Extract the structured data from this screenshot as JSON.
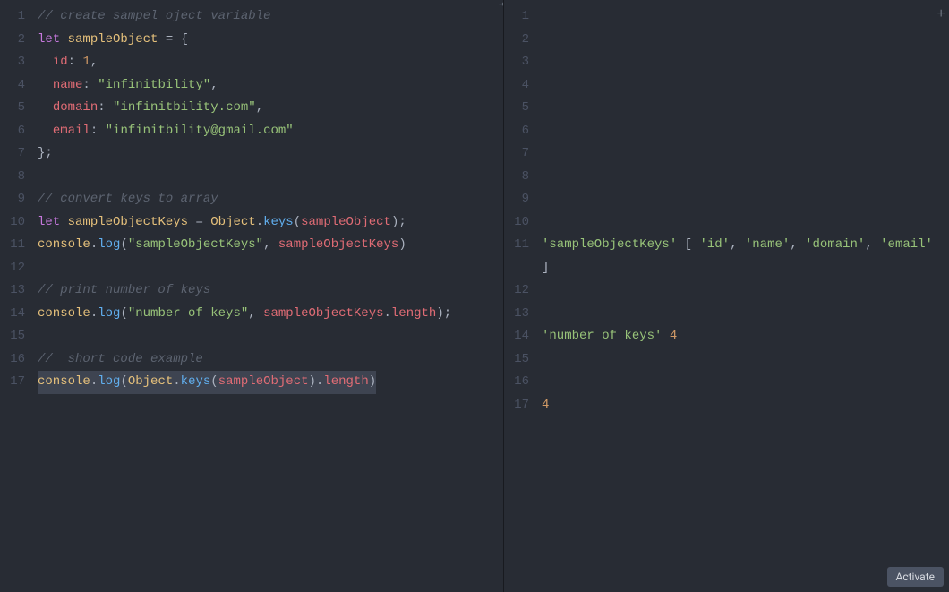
{
  "leftPane": {
    "lines": [
      {
        "n": 1,
        "tokens": [
          [
            "tk-comment",
            "// create sampel oject variable"
          ]
        ]
      },
      {
        "n": 2,
        "tokens": [
          [
            "tk-keyword",
            "let"
          ],
          [
            "tk-default",
            " "
          ],
          [
            "tk-var",
            "sampleObject"
          ],
          [
            "tk-default",
            " "
          ],
          [
            "tk-op",
            "="
          ],
          [
            "tk-default",
            " "
          ],
          [
            "tk-punc",
            "{"
          ]
        ]
      },
      {
        "n": 3,
        "tokens": [
          [
            "tk-default",
            "  "
          ],
          [
            "tk-prop",
            "id"
          ],
          [
            "tk-punc",
            ":"
          ],
          [
            "tk-default",
            " "
          ],
          [
            "tk-num",
            "1"
          ],
          [
            "tk-punc",
            ","
          ]
        ]
      },
      {
        "n": 4,
        "tokens": [
          [
            "tk-default",
            "  "
          ],
          [
            "tk-prop",
            "name"
          ],
          [
            "tk-punc",
            ":"
          ],
          [
            "tk-default",
            " "
          ],
          [
            "tk-str",
            "\"infinitbility\""
          ],
          [
            "tk-punc",
            ","
          ]
        ]
      },
      {
        "n": 5,
        "tokens": [
          [
            "tk-default",
            "  "
          ],
          [
            "tk-prop",
            "domain"
          ],
          [
            "tk-punc",
            ":"
          ],
          [
            "tk-default",
            " "
          ],
          [
            "tk-str",
            "\"infinitbility.com\""
          ],
          [
            "tk-punc",
            ","
          ]
        ]
      },
      {
        "n": 6,
        "tokens": [
          [
            "tk-default",
            "  "
          ],
          [
            "tk-prop",
            "email"
          ],
          [
            "tk-punc",
            ":"
          ],
          [
            "tk-default",
            " "
          ],
          [
            "tk-str",
            "\"infinitbility@gmail.com\""
          ]
        ]
      },
      {
        "n": 7,
        "tokens": [
          [
            "tk-punc",
            "};"
          ]
        ]
      },
      {
        "n": 8,
        "tokens": []
      },
      {
        "n": 9,
        "tokens": [
          [
            "tk-comment",
            "// convert keys to array"
          ]
        ]
      },
      {
        "n": 10,
        "tokens": [
          [
            "tk-keyword",
            "let"
          ],
          [
            "tk-default",
            " "
          ],
          [
            "tk-var",
            "sampleObjectKeys"
          ],
          [
            "tk-default",
            " "
          ],
          [
            "tk-op",
            "="
          ],
          [
            "tk-default",
            " "
          ],
          [
            "tk-class",
            "Object"
          ],
          [
            "tk-punc",
            "."
          ],
          [
            "tk-func",
            "keys"
          ],
          [
            "tk-punc",
            "("
          ],
          [
            "tk-ident",
            "sampleObject"
          ],
          [
            "tk-punc",
            ")"
          ],
          [
            "tk-punc",
            ";"
          ]
        ]
      },
      {
        "n": 11,
        "tokens": [
          [
            "tk-class",
            "console"
          ],
          [
            "tk-punc",
            "."
          ],
          [
            "tk-func",
            "log"
          ],
          [
            "tk-punc",
            "("
          ],
          [
            "tk-str",
            "\"sampleObjectKeys\""
          ],
          [
            "tk-punc",
            ","
          ],
          [
            "tk-default",
            " "
          ],
          [
            "tk-ident",
            "sampleObjectKeys"
          ],
          [
            "tk-punc",
            ")"
          ]
        ]
      },
      {
        "n": 12,
        "tokens": []
      },
      {
        "n": 13,
        "tokens": [
          [
            "tk-comment",
            "// print number of keys"
          ]
        ]
      },
      {
        "n": 14,
        "tokens": [
          [
            "tk-class",
            "console"
          ],
          [
            "tk-punc",
            "."
          ],
          [
            "tk-func",
            "log"
          ],
          [
            "tk-punc",
            "("
          ],
          [
            "tk-str",
            "\"number of keys\""
          ],
          [
            "tk-punc",
            ","
          ],
          [
            "tk-default",
            " "
          ],
          [
            "tk-ident",
            "sampleObjectKeys"
          ],
          [
            "tk-punc",
            "."
          ],
          [
            "tk-prop",
            "length"
          ],
          [
            "tk-punc",
            ")"
          ],
          [
            "tk-punc",
            ";"
          ]
        ]
      },
      {
        "n": 15,
        "tokens": []
      },
      {
        "n": 16,
        "tokens": [
          [
            "tk-comment",
            "//  short code example"
          ]
        ]
      },
      {
        "n": 17,
        "selected": true,
        "tokens": [
          [
            "tk-class",
            "console"
          ],
          [
            "tk-punc",
            "."
          ],
          [
            "tk-func",
            "log"
          ],
          [
            "tk-punc",
            "("
          ],
          [
            "tk-class",
            "Object"
          ],
          [
            "tk-punc",
            "."
          ],
          [
            "tk-func",
            "keys"
          ],
          [
            "tk-punc",
            "("
          ],
          [
            "tk-ident",
            "sampleObject"
          ],
          [
            "tk-punc",
            ")"
          ],
          [
            "tk-punc",
            "."
          ],
          [
            "tk-prop",
            "length"
          ],
          [
            "tk-punc",
            ")"
          ]
        ]
      }
    ]
  },
  "rightPane": {
    "lines": [
      {
        "n": 1,
        "tokens": []
      },
      {
        "n": 2,
        "tokens": []
      },
      {
        "n": 3,
        "tokens": []
      },
      {
        "n": 4,
        "tokens": []
      },
      {
        "n": 5,
        "tokens": []
      },
      {
        "n": 6,
        "tokens": []
      },
      {
        "n": 7,
        "tokens": []
      },
      {
        "n": 8,
        "tokens": []
      },
      {
        "n": 9,
        "tokens": []
      },
      {
        "n": 10,
        "tokens": []
      },
      {
        "n": 11,
        "wrap": true,
        "tokens": [
          [
            "out-str",
            "'sampleObjectKeys'"
          ],
          [
            "out-def",
            " "
          ],
          [
            "out-def",
            "["
          ],
          [
            "out-def",
            " "
          ],
          [
            "out-str",
            "'id'"
          ],
          [
            "out-def",
            ", "
          ],
          [
            "out-str",
            "'name'"
          ],
          [
            "out-def",
            ", "
          ],
          [
            "out-str",
            "'domain'"
          ],
          [
            "out-def",
            ", "
          ],
          [
            "out-str",
            "'email'"
          ],
          [
            "out-def",
            " "
          ],
          [
            "out-def",
            "]"
          ]
        ]
      },
      {
        "n": 12,
        "tokens": []
      },
      {
        "n": 13,
        "tokens": []
      },
      {
        "n": 14,
        "tokens": [
          [
            "out-str",
            "'number of keys'"
          ],
          [
            "out-def",
            " "
          ],
          [
            "out-num",
            "4"
          ]
        ]
      },
      {
        "n": 15,
        "tokens": []
      },
      {
        "n": 16,
        "tokens": []
      },
      {
        "n": 17,
        "tokens": [
          [
            "out-num",
            "4"
          ]
        ]
      }
    ]
  },
  "activateLabel": "Activate"
}
